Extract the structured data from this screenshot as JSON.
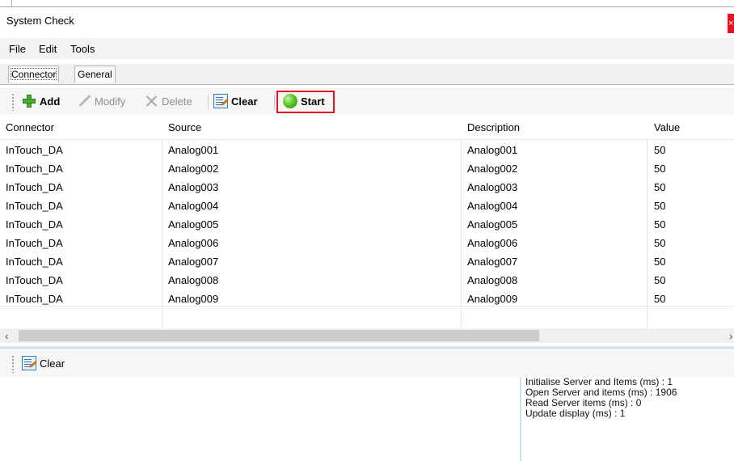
{
  "window": {
    "title": "System Check",
    "close_glyph": "×",
    "accent_close": "#e81123"
  },
  "menu": {
    "items": [
      "File",
      "Edit",
      "Tools"
    ]
  },
  "tabs": [
    {
      "label": "Connector",
      "active": true
    },
    {
      "label": "General",
      "active": false
    }
  ],
  "toolbar": {
    "add": {
      "label": "Add",
      "icon": "plus-icon",
      "enabled": true
    },
    "modify": {
      "label": "Modify",
      "icon": "pencil-icon",
      "enabled": false
    },
    "delete": {
      "label": "Delete",
      "icon": "x-icon",
      "enabled": false
    },
    "clear": {
      "label": "Clear",
      "icon": "clear-icon",
      "enabled": true
    },
    "start": {
      "label": "Start",
      "icon": "green-dot-icon",
      "enabled": true,
      "highlight_color": "#e3101f"
    }
  },
  "grid": {
    "columns": [
      "Connector",
      "Source",
      "Description",
      "Value"
    ],
    "rows": [
      [
        "InTouch_DA",
        "Analog001",
        "Analog001",
        "50"
      ],
      [
        "InTouch_DA",
        "Analog002",
        "Analog002",
        "50"
      ],
      [
        "InTouch_DA",
        "Analog003",
        "Analog003",
        "50"
      ],
      [
        "InTouch_DA",
        "Analog004",
        "Analog004",
        "50"
      ],
      [
        "InTouch_DA",
        "Analog005",
        "Analog005",
        "50"
      ],
      [
        "InTouch_DA",
        "Analog006",
        "Analog006",
        "50"
      ],
      [
        "InTouch_DA",
        "Analog007",
        "Analog007",
        "50"
      ],
      [
        "InTouch_DA",
        "Analog008",
        "Analog008",
        "50"
      ],
      [
        "InTouch_DA",
        "Analog009",
        "Analog009",
        "50"
      ]
    ]
  },
  "scrollbar": {
    "left_glyph": "‹",
    "right_glyph": "›"
  },
  "lower_toolbar": {
    "clear": {
      "label": "Clear",
      "icon": "clear-icon"
    }
  },
  "log": {
    "lines": [
      "Initialise Server and Items (ms) : 1",
      "Open Server and items (ms) : 1906",
      "Read Server items (ms) : 0",
      "Update display (ms) : 1"
    ]
  }
}
